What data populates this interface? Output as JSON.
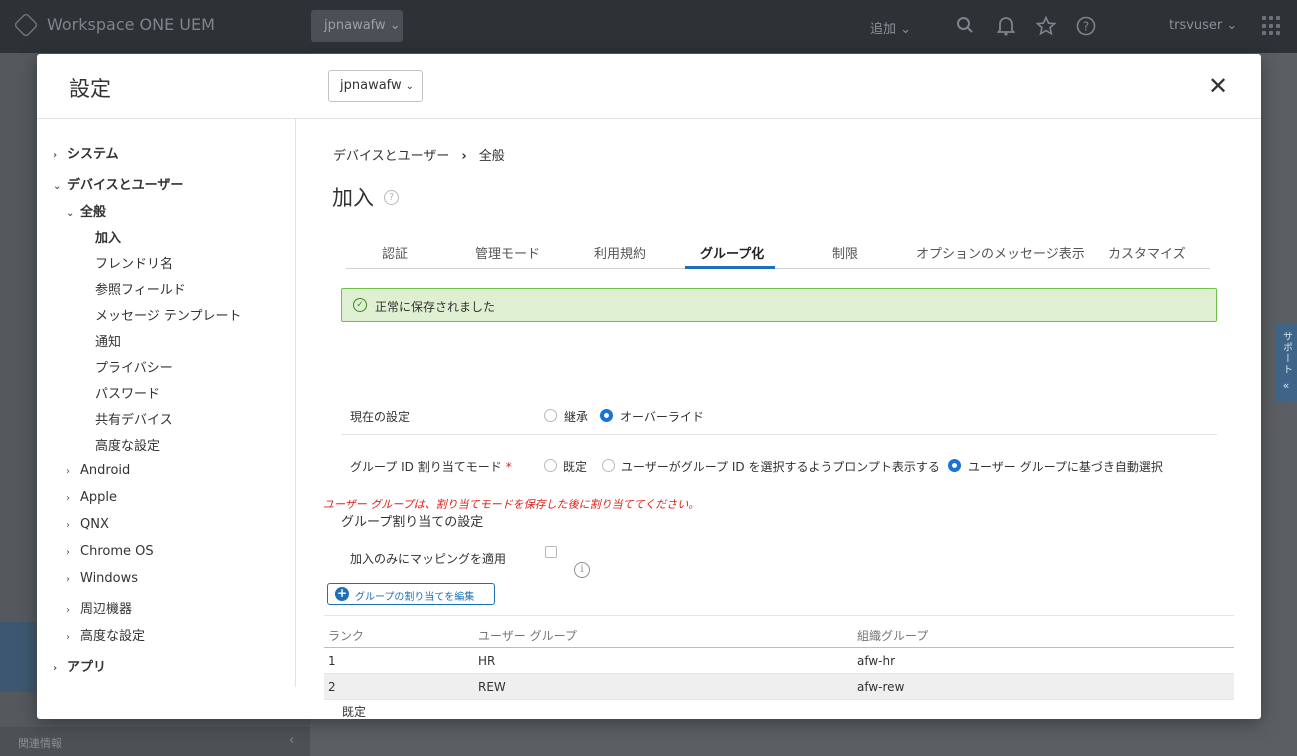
{
  "topbar": {
    "brand": "Workspace ONE UEM",
    "org_group": "jpnawafw ⌄",
    "add": "追加 ⌄",
    "user": "trsvuser ⌄"
  },
  "background": {
    "footer_label": "関連情報",
    "footer_chevron": "‹"
  },
  "support": {
    "label": "サポート",
    "chevron": "«"
  },
  "modal": {
    "title": "設定",
    "org_select": "jpnawafw",
    "close": "✕"
  },
  "nav": {
    "system": "システム",
    "devices_users": "デバイスとユーザー",
    "general": "全般",
    "enrollment": "加入",
    "friendly_name": "フレンドリ名",
    "lookup_fields": "参照フィールド",
    "message_template": "メッセージ テンプレート",
    "notification": "通知",
    "privacy": "プライバシー",
    "password": "パスワード",
    "shared_device": "共有デバイス",
    "advanced_sub": "高度な設定",
    "android": "Android",
    "apple": "Apple",
    "qnx": "QNX",
    "chrome_os": "Chrome OS",
    "windows": "Windows",
    "peripherals": "周辺機器",
    "advanced": "高度な設定",
    "apps": "アプリ"
  },
  "breadcrumb": {
    "parent": "デバイスとユーザー",
    "sep": "›",
    "current": "全般"
  },
  "page": {
    "title": "加入",
    "help": "?"
  },
  "tabs": [
    "認証",
    "管理モード",
    "利用規約",
    "グループ化",
    "制限",
    "オプションのメッセージ表示",
    "カスタマイズ"
  ],
  "active_tab": "グループ化",
  "success_message": "正常に保存されました",
  "current_setting": {
    "label": "現在の設定",
    "inherit": "継承",
    "override": "オーバーライド",
    "selected": "オーバーライド"
  },
  "group_id_mode": {
    "label": "グループ ID 割り当てモード",
    "required": "*",
    "default": "既定",
    "prompt": "ユーザーがグループ ID を選択するようプロンプト表示する",
    "auto": "ユーザー グループに基づき自動選択",
    "selected": "ユーザー グループに基づき自動選択"
  },
  "warning": "ユーザー グループは、割り当てモードを保存した後に割り当ててください。",
  "group_assignment": {
    "heading": "グループ割り当ての設定",
    "apply_label": "加入のみにマッピングを適用",
    "apply_checked": false,
    "edit_button": "グループの割り当てを編集"
  },
  "table": {
    "headers": [
      "ランク",
      "ユーザー グループ",
      "組織グループ"
    ],
    "rows": [
      [
        "1",
        "HR",
        "afw-hr"
      ],
      [
        "2",
        "REW",
        "afw-rew"
      ]
    ]
  },
  "default_label": "既定"
}
